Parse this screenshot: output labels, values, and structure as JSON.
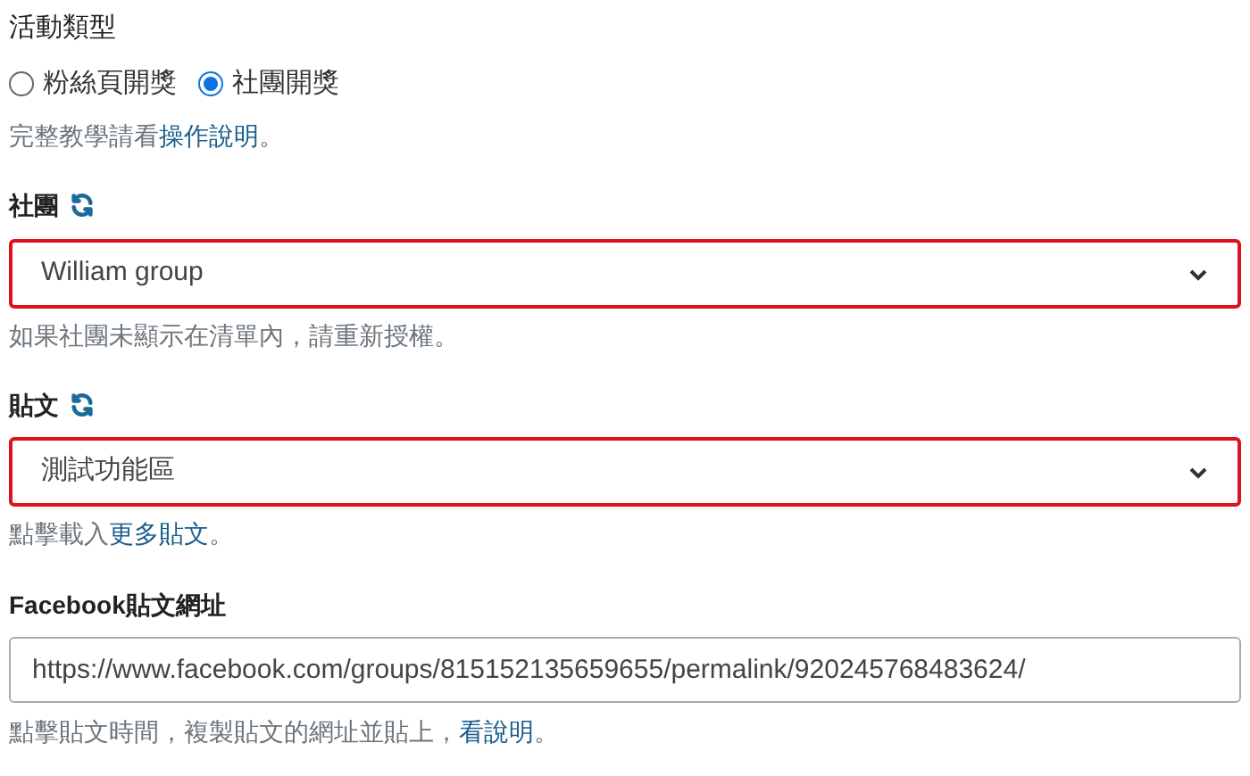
{
  "activity_type": {
    "label": "活動類型",
    "options": [
      {
        "label": "粉絲頁開獎",
        "selected": false
      },
      {
        "label": "社團開獎",
        "selected": true
      }
    ],
    "help": {
      "before": "完整教學請看",
      "link": "操作說明",
      "after": "。"
    }
  },
  "group": {
    "label": "社團",
    "value": "William group",
    "error": true,
    "help": {
      "before": "如果社團未顯示在清單內，請重新授權。"
    }
  },
  "post": {
    "label": "貼文",
    "value": "測試功能區",
    "error": true,
    "help": {
      "before": "點擊載入",
      "link": "更多貼文",
      "after": "。"
    }
  },
  "post_url": {
    "label": "Facebook貼文網址",
    "value": "https://www.facebook.com/groups/815152135659655/permalink/920245768483624/",
    "help": {
      "before": "點擊貼文時間，複製貼文的網址並貼上，",
      "link": "看說明",
      "after": "。"
    }
  }
}
